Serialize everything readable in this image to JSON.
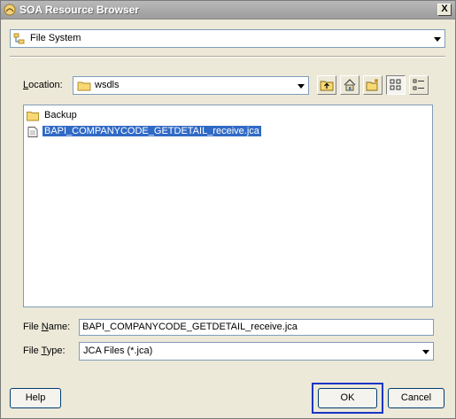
{
  "window": {
    "title": "SOA Resource Browser",
    "close_label": "X"
  },
  "resource_type": {
    "selected": "File System"
  },
  "location": {
    "label_prefix": "L",
    "label_rest": "ocation:",
    "value": "wsdls"
  },
  "toolbar": {
    "icons": [
      "up-folder-icon",
      "home-icon",
      "new-folder-icon",
      "icon-view-icon",
      "list-view-icon"
    ]
  },
  "files": [
    {
      "name": "Backup",
      "type": "folder",
      "selected": false
    },
    {
      "name": "BAPI_COMPANYCODE_GETDETAIL_receive.jca",
      "type": "file",
      "selected": true
    }
  ],
  "file_name": {
    "label_pre": "File ",
    "label_u": "N",
    "label_post": "ame:",
    "value": "BAPI_COMPANYCODE_GETDETAIL_receive.jca"
  },
  "file_type": {
    "label_pre": "File ",
    "label_u": "T",
    "label_post": "ype:",
    "value": "JCA Files (*.jca)"
  },
  "buttons": {
    "help": "Help",
    "ok": "OK",
    "cancel": "Cancel"
  },
  "colors": {
    "selection": "#316ac5",
    "highlight": "#1a35c8"
  }
}
